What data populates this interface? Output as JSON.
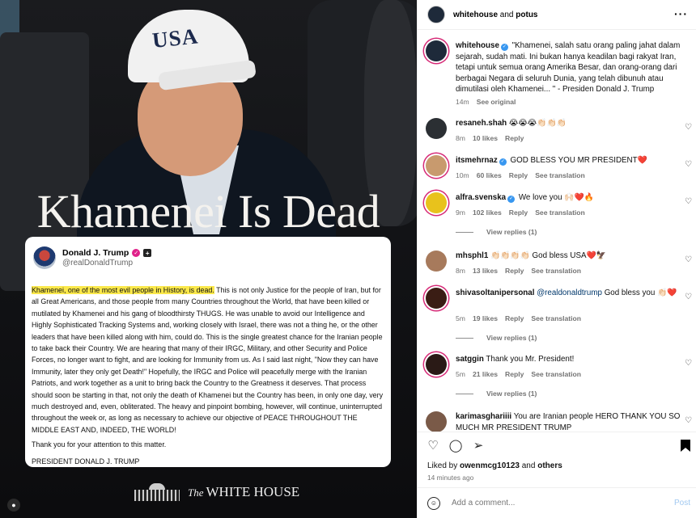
{
  "post_image": {
    "cap_text": "USA",
    "headline": "Khamenei Is Dead",
    "tweet": {
      "author_name": "Donald J. Trump",
      "author_handle": "@realDonaldTrump",
      "body_highlight": "Khamenei, one of the most evil people in History, is dead.",
      "body_rest": " This is not only Justice for the people of Iran, but for all Great Americans, and those people from many Countries throughout the World, that have been killed or mutilated by Khamenei and his gang of bloodthirsty THUGS. He was unable to avoid our Intelligence and Highly Sophisticated Tracking Systems and, working closely with Israel, there was not a thing he, or the other leaders that have been killed along with him, could do. This is the single greatest chance for the Iranian people to take back their Country. We are hearing that many of their IRGC, Military, and other Security and Police Forces, no longer want to fight, and are looking for Immunity from us. As I said last night, \"Now they can have Immunity, later they only get Death!\" Hopefully, the IRGC and Police will peacefully merge with the Iranian Patriots, and work together as a unit to bring back the Country to the Greatness it deserves. That process should soon be starting in that, not only the death of Khamenei but the Country has been, in only one day, very much destroyed and, even, obliterated. The heavy and pinpoint bombing, however, will continue, uninterrupted throughout the week or, as long as necessary to achieve our objective of PEACE THROUGHOUT THE MIDDLE EAST AND, INDEED, THE WORLD!",
      "thanks": "Thank you for your attention to this matter.",
      "signature": "PRESIDENT DONALD J. TRUMP"
    },
    "footer_the": "The",
    "footer_name": "WHITE HOUSE"
  },
  "header": {
    "account": "whitehouse",
    "joiner": "and",
    "collaborator": "potus",
    "more_label": "···"
  },
  "caption": {
    "username": "whitehouse",
    "text": "\"Khamenei, salah satu orang paling jahat dalam sejarah, sudah mati. Ini bukan hanya keadilan bagi rakyat Iran, tetapi untuk semua orang Amerika Besar, dan orang-orang dari berbagai Negara di seluruh Dunia, yang telah dibunuh atau dimutilasi oleh Khamenei... \" - Presiden Donald J. Trump",
    "time": "14m",
    "see_original": "See original"
  },
  "comments": [
    {
      "username": "resaneh.shah",
      "verified": false,
      "text": "😭😭😭👏🏻👏🏻👏🏻",
      "time": "8m",
      "likes": "10 likes",
      "reply": "Reply",
      "translate": "",
      "view_replies": ""
    },
    {
      "username": "itsmehrnaz",
      "verified": true,
      "text": "GOD BLESS YOU MR PRESIDENT❤️",
      "time": "10m",
      "likes": "60 likes",
      "reply": "Reply",
      "translate": "See translation",
      "view_replies": ""
    },
    {
      "username": "alfra.svenska",
      "verified": true,
      "text": "We love you 🙌🏻❤️🔥",
      "time": "9m",
      "likes": "102 likes",
      "reply": "Reply",
      "translate": "See translation",
      "view_replies": "View replies (1)"
    },
    {
      "username": "mhsphl1",
      "verified": false,
      "text": "👏🏻👏🏻👏🏻👏🏻 God bless USA❤️🦅",
      "time": "8m",
      "likes": "13 likes",
      "reply": "Reply",
      "translate": "See translation",
      "view_replies": ""
    },
    {
      "username": "shivasoltanipersonal",
      "verified": false,
      "mention": "@realdonaldtrump",
      "text": "God bless you 👏🏻❤️",
      "time": "5m",
      "likes": "19 likes",
      "reply": "Reply",
      "translate": "See translation",
      "view_replies": "View replies (1)"
    },
    {
      "username": "satggin",
      "verified": false,
      "text": "Thank you Mr. President!",
      "time": "5m",
      "likes": "21 likes",
      "reply": "Reply",
      "translate": "See translation",
      "view_replies": "View replies (1)"
    },
    {
      "username": "karimasghariiii",
      "verified": false,
      "text": "You are Iranian people HERO THANK YOU SO MUCH MR PRESIDENT TRUMP",
      "time": "",
      "likes": "",
      "reply": "",
      "translate": "",
      "view_replies": ""
    }
  ],
  "likes_line": {
    "prefix": "Liked by",
    "user": "owenmcg10123",
    "and": "and",
    "others": "others"
  },
  "posted_ago": "14 minutes ago",
  "add_comment": {
    "placeholder": "Add a comment...",
    "post_label": "Post"
  },
  "icons": [
    "heart-icon",
    "comment-icon",
    "share-icon",
    "bookmark-icon",
    "emoji-icon",
    "more-icon",
    "tag-user-icon"
  ]
}
